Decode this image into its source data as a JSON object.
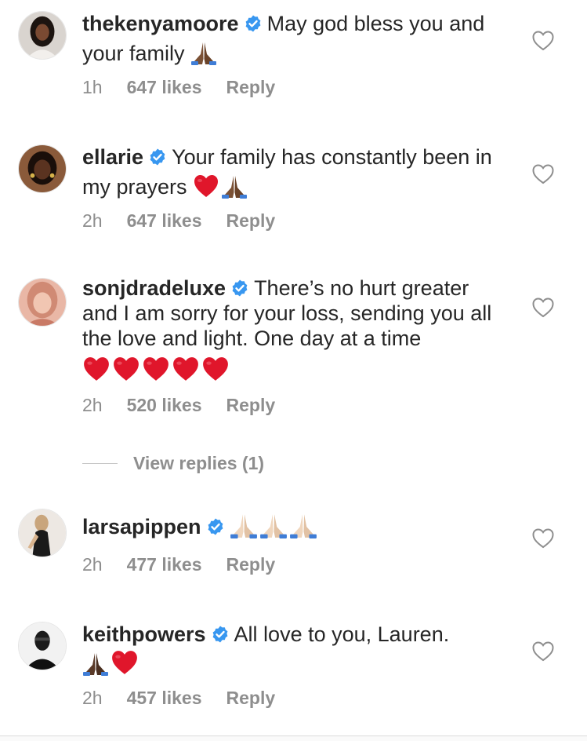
{
  "comments": [
    {
      "username": "thekenyamoore",
      "verified": true,
      "text": "May god bless you and your family",
      "emojis_after": [
        "folded-hands-dark"
      ],
      "time": "1h",
      "likes": "647 likes",
      "reply": "Reply"
    },
    {
      "username": "ellarie",
      "verified": true,
      "text": "Your family has constantly been in my prayers",
      "emojis_after": [
        "red-heart",
        "folded-hands-dark"
      ],
      "time": "2h",
      "likes": "647 likes",
      "reply": "Reply"
    },
    {
      "username": "sonjdradeluxe",
      "verified": true,
      "text": "There’s no hurt greater and I am sorry for your loss, sending you all the love and light.  One day at a time",
      "emojis_after": [
        "red-heart",
        "red-heart",
        "red-heart",
        "red-heart",
        "red-heart"
      ],
      "time": "2h",
      "likes": "520 likes",
      "reply": "Reply"
    },
    {
      "username": "larsapippen",
      "verified": true,
      "text": "",
      "emojis_after": [
        "folded-hands-light",
        "folded-hands-light",
        "folded-hands-light"
      ],
      "time": "2h",
      "likes": "477 likes",
      "reply": "Reply"
    },
    {
      "username": "keithpowers",
      "verified": true,
      "text": "All love to you, Lauren.",
      "emojis_after": [
        "folded-hands-dark",
        "red-heart"
      ],
      "time": "2h",
      "likes": "457 likes",
      "reply": "Reply"
    }
  ],
  "view_replies": "View replies (1)",
  "icons": {
    "verified": "verified-badge-icon",
    "like": "heart-outline-icon"
  },
  "colors": {
    "verified_blue": "#3897f0",
    "text": "#262626",
    "meta_gray": "#8e8e8e",
    "heart_red": "#e0162b"
  }
}
